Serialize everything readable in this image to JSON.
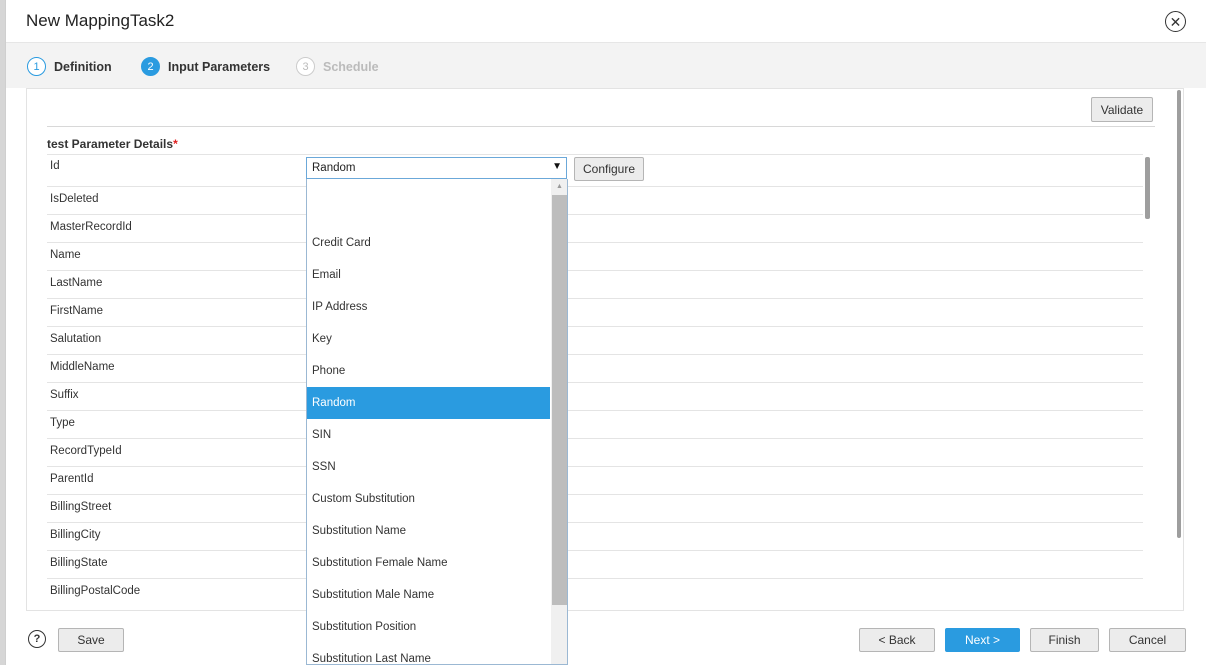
{
  "dialog": {
    "title": "New MappingTask2",
    "close_glyph": "✕"
  },
  "steps": [
    {
      "num": "1",
      "label": "Definition",
      "state": "completed"
    },
    {
      "num": "2",
      "label": "Input Parameters",
      "state": "active"
    },
    {
      "num": "3",
      "label": "Schedule",
      "state": "disabled"
    }
  ],
  "toolbar": {
    "validate_label": "Validate"
  },
  "section": {
    "title": "test Parameter Details",
    "required_mark": "*"
  },
  "fields": [
    "Id",
    "IsDeleted",
    "MasterRecordId",
    "Name",
    "LastName",
    "FirstName",
    "Salutation",
    "MiddleName",
    "Suffix",
    "Type",
    "RecordTypeId",
    "ParentId",
    "BillingStreet",
    "BillingCity",
    "BillingState",
    "BillingPostalCode"
  ],
  "select": {
    "value": "Random",
    "arrow_glyph": "▼"
  },
  "configure_label": "Configure",
  "dropdown": {
    "options": [
      "",
      "Credit Card",
      "Email",
      "IP Address",
      "Key",
      "Phone",
      "Random",
      "SIN",
      "SSN",
      "Custom Substitution",
      "Substitution Name",
      "Substitution Female Name",
      "Substitution Male Name",
      "Substitution Position",
      "Substitution Last Name"
    ],
    "selected": "Random",
    "scroll_up_glyph": "▲"
  },
  "footer": {
    "help_glyph": "?",
    "save_label": "Save",
    "back_label": "< Back",
    "next_label": "Next >",
    "finish_label": "Finish",
    "cancel_label": "Cancel"
  },
  "colors": {
    "accent": "#2a9be0",
    "required": "#e02020"
  }
}
